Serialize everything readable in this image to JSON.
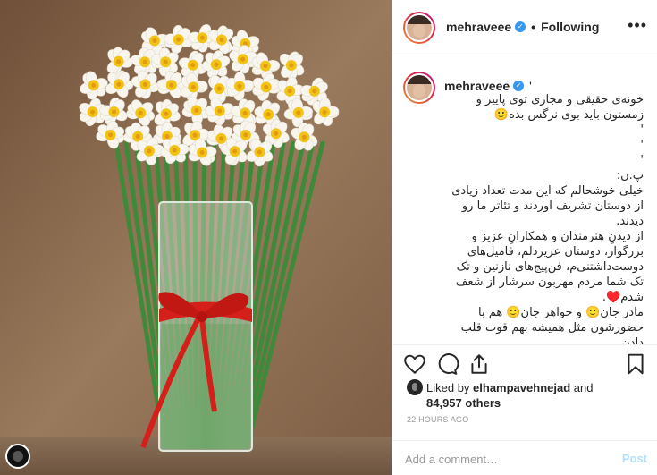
{
  "post": {
    "photo_alt": "",
    "username": "mehraveee",
    "follow_status": "Following",
    "header_separator": "•",
    "more_icon": "more-horizontal-icon",
    "verified_icon": "verified-badge-icon"
  },
  "caption": {
    "username": "mehraveee",
    "tick": "'",
    "text": "خونه‌ی حقیقی و مجازی توی پاییز و زمستون باید بوی نرگس بده🙂\n'\n'\n'\nپ.ن:\nخیلی خوشحالم که این مدت تعداد زیادی از دوستان تشریف آوردند و تئاتر ما رو دیدند.\nاز دیدنِ هنرمندان و همکارانِ عزیز و بزرگوار، دوستان عزیزدلم، فامیل‌های دوست‌داشتنی‌م، فن‌پیج‌های نازنین و تک تک شما مردم مهربون سرشار از شعف شدم♥️.\nمادر جان🙂 و خواهر جان🙂 هم با حضورشون مثل همیشه بهم قوت قلب دادن.\n🙂♥️"
  },
  "actions": {
    "like_icon": "heart-icon",
    "comment_icon": "comment-icon",
    "share_icon": "share-icon",
    "save_icon": "bookmark-icon"
  },
  "likes": {
    "prefix": "Liked by",
    "liker": "elhampavehnejad",
    "conjunction": "and",
    "others": "84,957 others"
  },
  "timestamp": "22 HOURS AGO",
  "comment_box": {
    "placeholder": "Add a comment…",
    "post_label": "Post"
  },
  "colors": {
    "accent": "#3897f0",
    "post_disabled": "#b2dffc",
    "ribbon": "#d41f1a",
    "flower_yellow": "#f2c317"
  }
}
